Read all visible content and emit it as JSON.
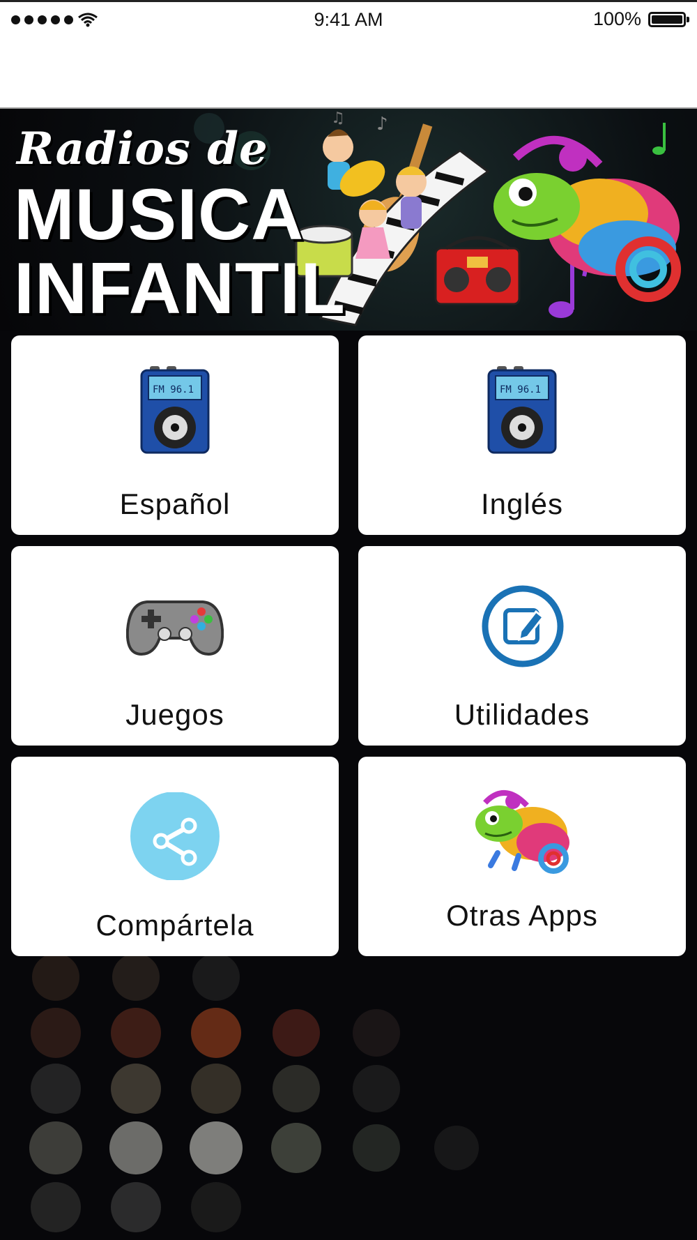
{
  "status_bar": {
    "signal_dots": 5,
    "wifi_icon": "wifi-icon",
    "time": "9:41 AM",
    "battery_percent": "100%",
    "battery_level": 1.0
  },
  "banner": {
    "line1": "Radios de",
    "line2": "MUSICA",
    "line3": "INFANTIL",
    "art": [
      "children-dancing",
      "guitar",
      "piano-keys",
      "drum",
      "boombox",
      "chameleon-headphones",
      "music-notes"
    ]
  },
  "menu": [
    {
      "label": "Español",
      "icon": "radio-icon"
    },
    {
      "label": "Inglés",
      "icon": "radio-icon"
    },
    {
      "label": "Juegos",
      "icon": "gamepad-icon"
    },
    {
      "label": "Utilidades",
      "icon": "edit-icon"
    },
    {
      "label": "Compártela",
      "icon": "share-icon"
    },
    {
      "label": "Otras Apps",
      "icon": "chameleon-icon"
    }
  ],
  "colors": {
    "background": "#07070a",
    "tile": "#ffffff",
    "utilities_blue": "#1a72b5",
    "share_bg": "#7dd3f0",
    "radio_blue": "#1f4fa8"
  }
}
